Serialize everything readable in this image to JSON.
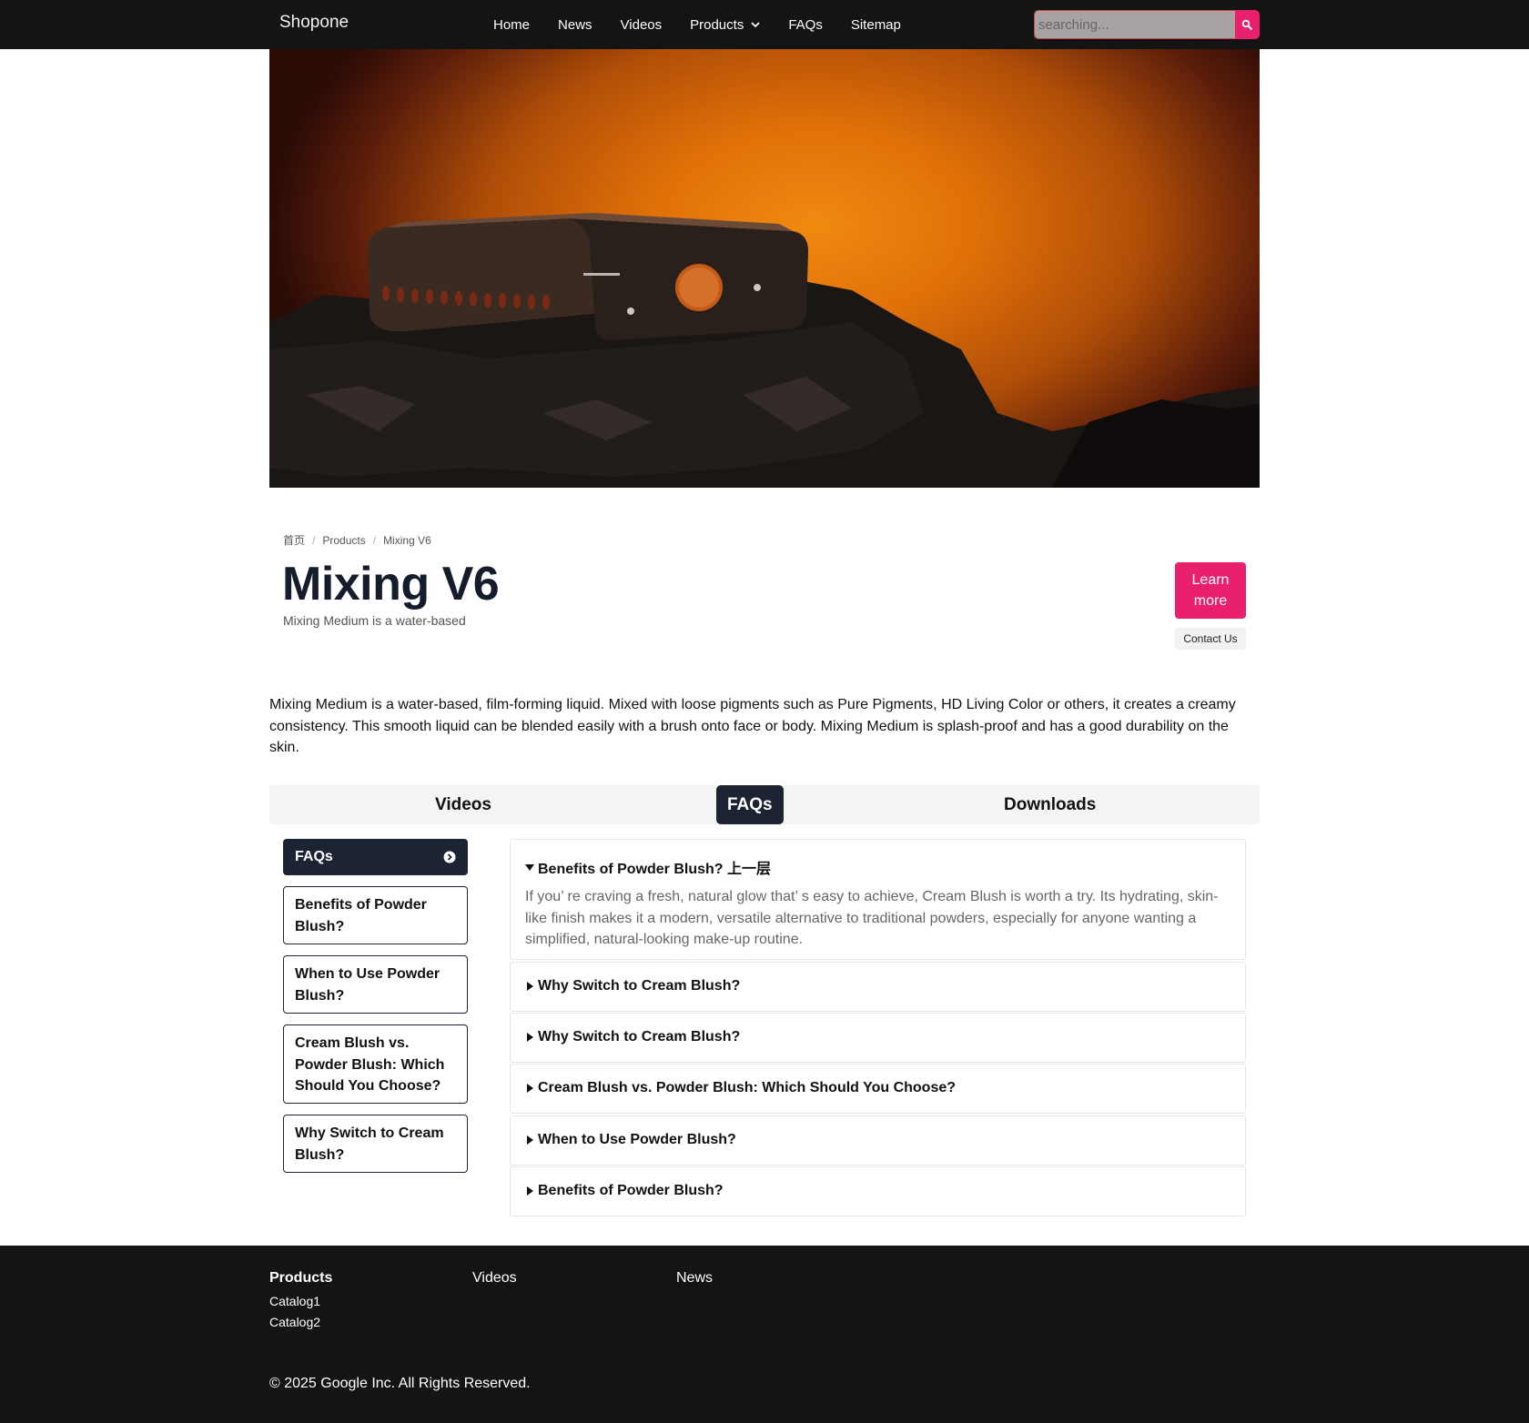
{
  "nav": {
    "brand": "Shopone",
    "links": [
      "Home",
      "News",
      "Videos",
      "Products",
      "FAQs",
      "Sitemap"
    ],
    "search_placeholder": "searching..."
  },
  "breadcrumb": [
    "首页",
    "Products",
    "Mixing V6"
  ],
  "product": {
    "title": "Mixing V6",
    "subtitle": "Mixing Medium is a water-based",
    "learn_more": "Learn more",
    "contact": "Contact Us",
    "description": "Mixing Medium is a water-based, film-forming liquid. Mixed with loose pigments such as Pure Pigments, HD Living Color or others, it creates a creamy consistency. This smooth liquid can be blended easily with a brush onto face or body. Mixing Medium is splash-proof and has a good durability on the skin."
  },
  "tabs": [
    "Videos",
    "FAQs",
    "Downloads"
  ],
  "sidebar": [
    "FAQs",
    "Benefits of Powder Blush?",
    "When to Use Powder Blush?",
    "Cream Blush vs. Powder Blush: Which Should You Choose?",
    "Why Switch to Cream Blush?"
  ],
  "faqs": [
    {
      "q": "Benefits of Powder Blush? 上一层",
      "a": "If you’ re craving a fresh, natural glow that’ s easy to achieve, Cream Blush is worth a try. Its hydrating, skin-like finish makes it a modern, versatile alternative to traditional powders, especially for anyone wanting a simplified, natural-looking make-up routine."
    },
    {
      "q": "Why Switch to Cream Blush?"
    },
    {
      "q": "Why Switch to Cream Blush?"
    },
    {
      "q": "Cream Blush vs. Powder Blush: Which Should You Choose?"
    },
    {
      "q": "When to Use Powder Blush?"
    },
    {
      "q": "Benefits of Powder Blush?"
    }
  ],
  "footer": {
    "products_title": "Products",
    "products_links": [
      "Catalog1",
      "Catalog2"
    ],
    "videos_title": "Videos",
    "news_title": "News",
    "copyright": "© 2025 Google Inc. All Rights Reserved."
  },
  "colors": {
    "accent": "#e9216c",
    "dark": "#1c2333",
    "nav_bg": "#141414"
  }
}
